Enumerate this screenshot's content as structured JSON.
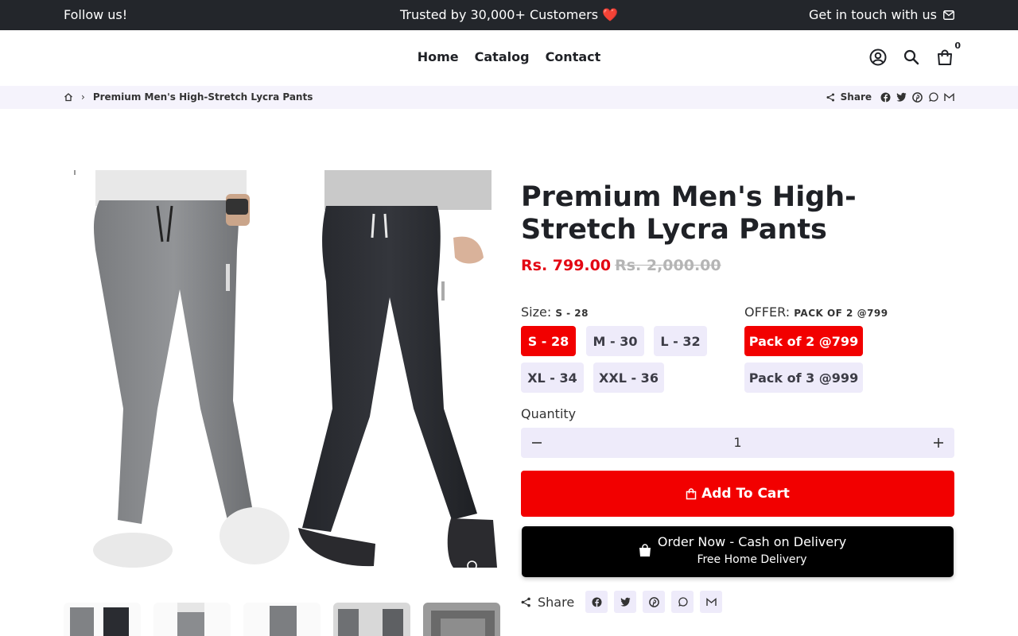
{
  "announcement": {
    "left": "Follow us!",
    "center": "Trusted by 30,000+ Customers",
    "center_emoji": "❤️",
    "right": "Get in touch with us"
  },
  "nav": {
    "items": [
      "Home",
      "Catalog",
      "Contact"
    ],
    "cart_count": "0"
  },
  "breadcrumb": {
    "current": "Premium Men's High-Stretch Lycra Pants",
    "share_label": "Share"
  },
  "product": {
    "title": "Premium Men's High-Stretch Lycra Pants",
    "price": "Rs. 799.00",
    "compare_price": "Rs. 2,000.00",
    "size": {
      "label": "Size:",
      "selected": "S - 28",
      "options": [
        "S - 28",
        "M - 30",
        "L - 32",
        "XL - 34",
        "XXL - 36"
      ]
    },
    "offer": {
      "label": "OFFER:",
      "selected": "PACK OF 2 @799",
      "options": [
        "Pack of 2 @799",
        "Pack of 3 @999"
      ]
    },
    "quantity": {
      "label": "Quantity",
      "value": "1"
    },
    "add_to_cart": "Add To Cart",
    "cod": {
      "line1": "Order Now - Cash on Delivery",
      "line2": "Free Home Delivery"
    },
    "share_label": "Share"
  },
  "colors": {
    "accent_red": "#f20000",
    "price_red": "#e30613",
    "chip_bg": "#eeebfa",
    "topbar_bg": "#23262b"
  }
}
